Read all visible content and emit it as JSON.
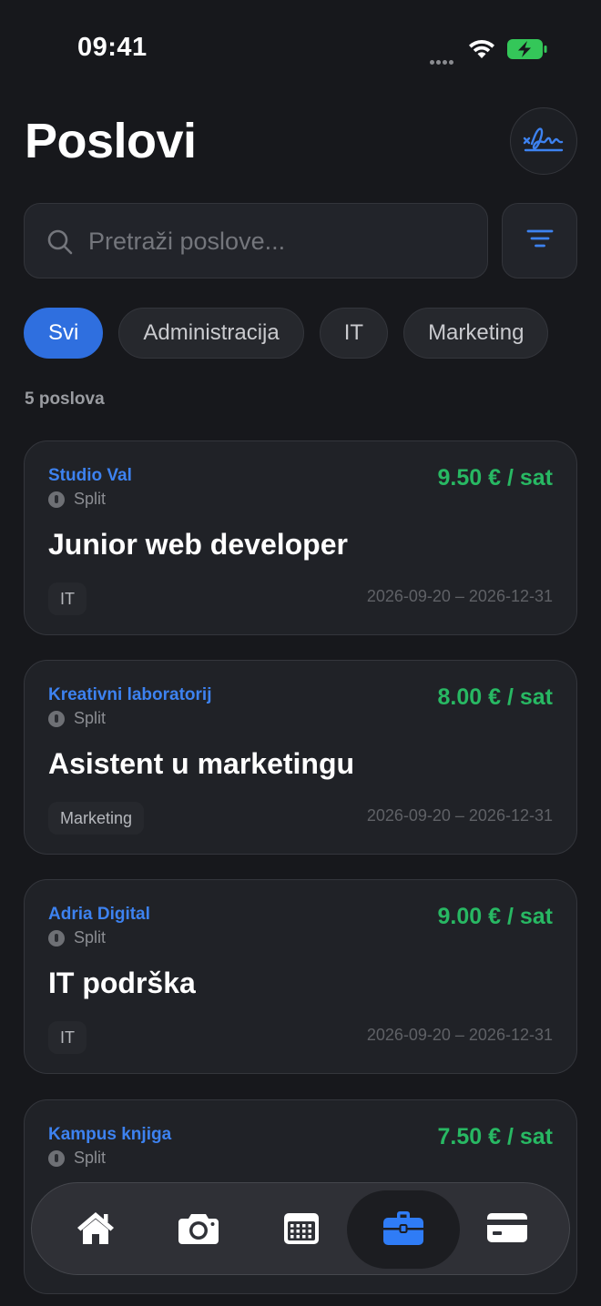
{
  "status": {
    "time": "09:41"
  },
  "header": {
    "title": "Poslovi",
    "sign_icon": "signature-icon"
  },
  "search": {
    "placeholder": "Pretraži poslove...",
    "value": ""
  },
  "filters": {
    "chips": [
      {
        "label": "Svi",
        "active": true
      },
      {
        "label": "Administracija",
        "active": false
      },
      {
        "label": "IT",
        "active": false
      },
      {
        "label": "Marketing",
        "active": false
      }
    ]
  },
  "results": {
    "count_label": "5 poslova"
  },
  "jobs": [
    {
      "company": "Studio Val",
      "location": "Split",
      "rate": "9.50 € / sat",
      "title": "Junior web developer",
      "tag": "IT",
      "dates": "2026-09-20 – 2026-12-31"
    },
    {
      "company": "Kreativni laboratorij",
      "location": "Split",
      "rate": "8.00 € / sat",
      "title": "Asistent u marketingu",
      "tag": "Marketing",
      "dates": "2026-09-20 – 2026-12-31"
    },
    {
      "company": "Adria Digital",
      "location": "Split",
      "rate": "9.00 € / sat",
      "title": "IT podrška",
      "tag": "IT",
      "dates": "2026-09-20 – 2026-12-31"
    },
    {
      "company": "Kampus knjiga",
      "location": "Split",
      "rate": "7.50 € / sat"
    }
  ],
  "tabbar": {
    "items": [
      {
        "icon": "home-icon",
        "active": false
      },
      {
        "icon": "camera-icon",
        "active": false
      },
      {
        "icon": "calendar-icon",
        "active": false
      },
      {
        "icon": "briefcase-icon",
        "active": true
      },
      {
        "icon": "card-icon",
        "active": false
      }
    ]
  },
  "colors": {
    "accent": "#2f6fdf",
    "company": "#3d82f0",
    "rate": "#28b863",
    "background": "#17181c",
    "card": "#202227"
  }
}
